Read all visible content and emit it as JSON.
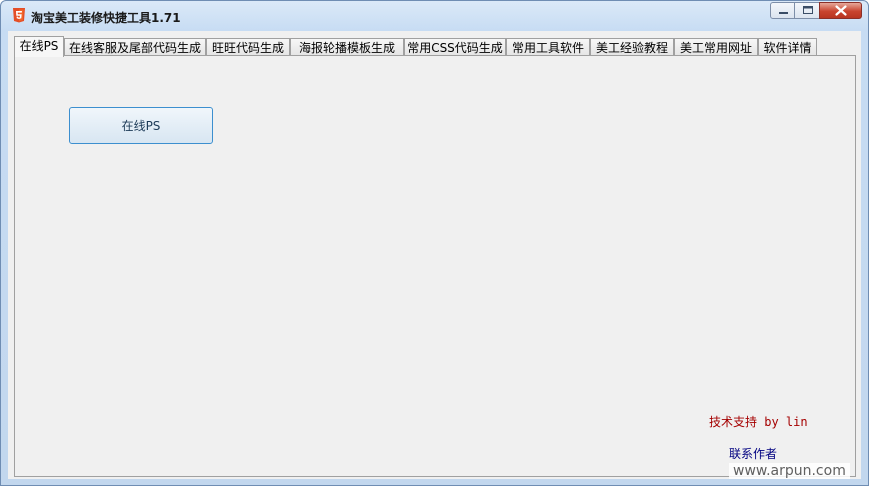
{
  "window": {
    "title": "淘宝美工装修快捷工具1.71",
    "icon": "html5-icon",
    "controls": {
      "minimize": "minimize-icon",
      "maximize": "maximize-icon",
      "close": "close-icon"
    }
  },
  "tabs": [
    {
      "label": "在线PS",
      "active": true
    },
    {
      "label": "在线客服及尾部代码生成",
      "active": false
    },
    {
      "label": "旺旺代码生成",
      "active": false
    },
    {
      "label": "海报轮播模板生成",
      "active": false
    },
    {
      "label": "常用CSS代码生成",
      "active": false
    },
    {
      "label": "常用工具软件",
      "active": false
    },
    {
      "label": "美工经验教程",
      "active": false
    },
    {
      "label": "美工常用网址",
      "active": false
    },
    {
      "label": "软件详情",
      "active": false
    }
  ],
  "panel": {
    "online_ps_button": "在线PS",
    "support_text": "技术支持 by lin",
    "contact_link": "联系作者"
  },
  "watermark": "www.arpun.com",
  "colors": {
    "support_text": "#a50000",
    "contact_link": "#000080",
    "button_border": "#3c8fcf",
    "close_button": "#c9442f"
  }
}
